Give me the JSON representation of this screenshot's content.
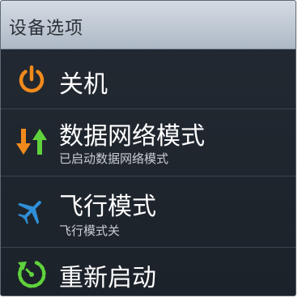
{
  "dialog": {
    "title": "设备选项"
  },
  "items": [
    {
      "key": "power_off",
      "label": "关机",
      "icon": "power-icon",
      "color": "#f08a1c"
    },
    {
      "key": "mobile_data",
      "label": "数据网络模式",
      "sublabel": "已启动数据网络模式",
      "icon": "data-arrows-icon",
      "colors": [
        "#f08a1c",
        "#5fd23c"
      ]
    },
    {
      "key": "airplane",
      "label": "飞行模式",
      "sublabel": "飞行模式关",
      "icon": "airplane-icon",
      "color": "#2f8fd8"
    },
    {
      "key": "restart",
      "label": "重新启动",
      "icon": "restart-icon",
      "color": "#5fd23c"
    }
  ]
}
